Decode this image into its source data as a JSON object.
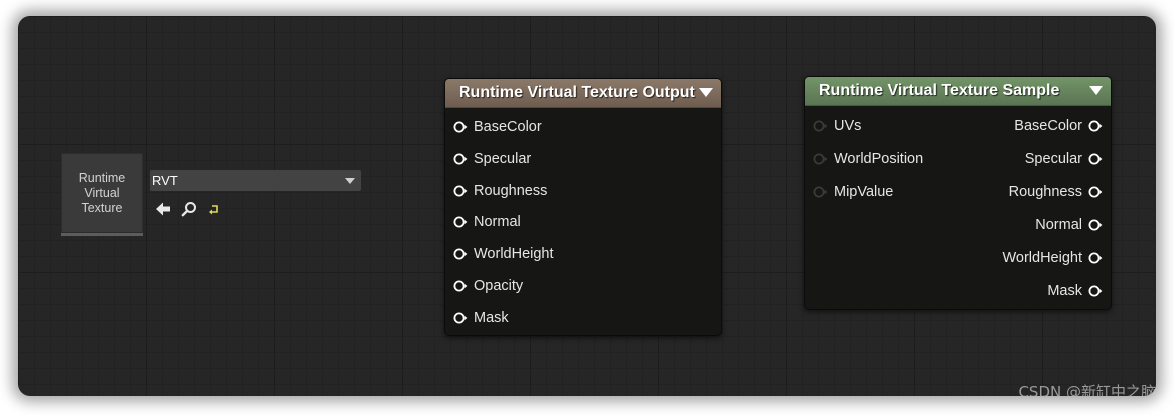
{
  "asset_node": {
    "thumbnail_label": "Runtime\nVirtual\nTexture",
    "combo_value": "RVT",
    "tools": [
      "arrow-left-icon",
      "search-icon",
      "reset-icon"
    ]
  },
  "output_node": {
    "title": "Runtime Virtual Texture Output",
    "header_color": "#7d6b5c",
    "inputs": [
      "BaseColor",
      "Specular",
      "Roughness",
      "Normal",
      "WorldHeight",
      "Opacity",
      "Mask"
    ]
  },
  "sample_node": {
    "title": "Runtime Virtual Texture Sample",
    "header_color": "#66845f",
    "inputs": [
      "UVs",
      "WorldPosition",
      "MipValue"
    ],
    "outputs": [
      "BaseColor",
      "Specular",
      "Roughness",
      "Normal",
      "WorldHeight",
      "Mask"
    ]
  },
  "colors": {
    "canvas": "#262626",
    "node_body": "#161614",
    "pin_connected": "#ffffff",
    "pin_unconnected": "#3a3a3a",
    "reset_icon": "#e0d85a"
  },
  "watermark": "CSDN @新缸中之脑"
}
